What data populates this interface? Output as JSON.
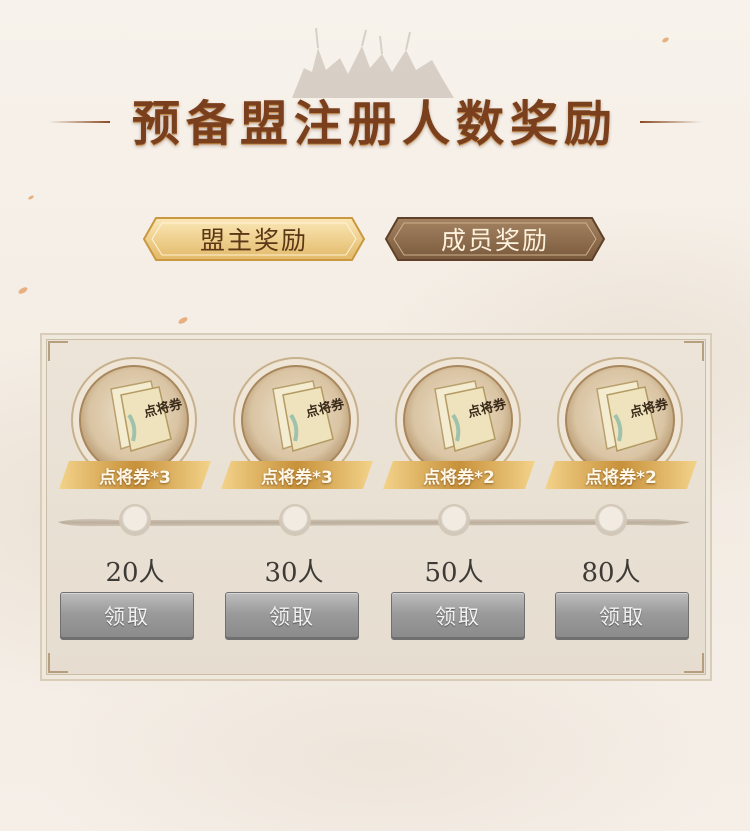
{
  "header": {
    "title": "预备盟注册人数奖励"
  },
  "tabs": [
    {
      "label": "盟主奖励",
      "selected": true
    },
    {
      "label": "成员奖励",
      "selected": false
    }
  ],
  "milestones": [
    {
      "reward_label": "点将券*3",
      "reward_icon": "scroll-ticket-icon",
      "count_label": "20人",
      "button_label": "领取"
    },
    {
      "reward_label": "点将券*3",
      "reward_icon": "scroll-ticket-icon",
      "count_label": "30人",
      "button_label": "领取"
    },
    {
      "reward_label": "点将券*2",
      "reward_icon": "scroll-ticket-icon",
      "count_label": "50人",
      "button_label": "领取"
    },
    {
      "reward_label": "点将券*2",
      "reward_icon": "scroll-ticket-icon",
      "count_label": "80人",
      "button_label": "领取"
    }
  ],
  "progress": {
    "reached_milestones": 0
  },
  "colors": {
    "title": "#7a3f1c",
    "tab_active": "#f0d38c",
    "tab_inactive": "#8a6a4b",
    "ribbon": "#d9a54a",
    "button_disabled": "#9a9a9a"
  }
}
